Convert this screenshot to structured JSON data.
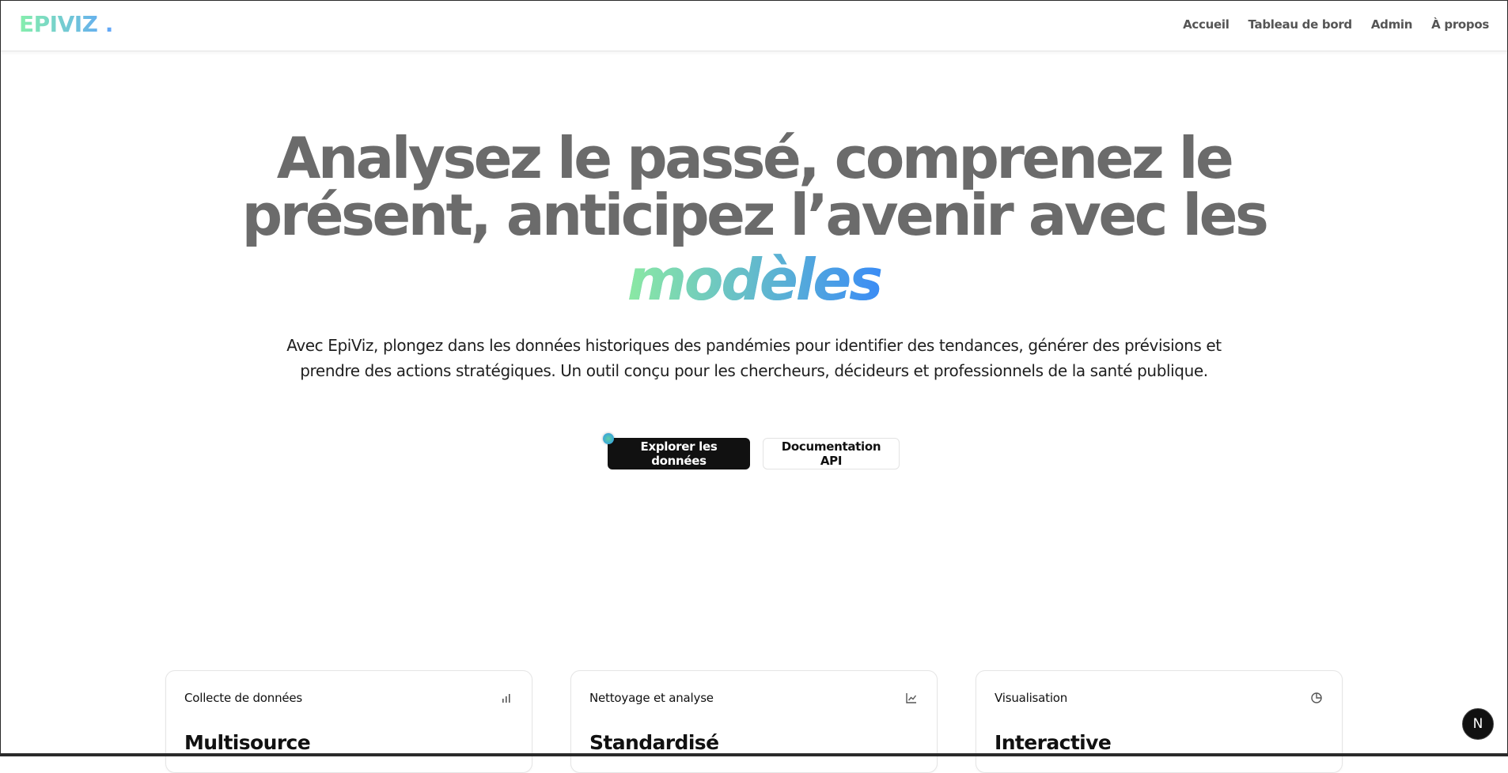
{
  "header": {
    "logo": "EPIVIZ .",
    "nav": [
      "Accueil",
      "Tableau de bord",
      "Admin",
      "À propos"
    ]
  },
  "hero": {
    "title_line1": "Analysez le passé, comprenez le",
    "title_line2": "présent, anticipez l’avenir avec les",
    "title_accent": "modèles",
    "subtitle": "Avec EpiViz, plongez dans les données historiques des pandémies pour identifier des tendances, générer des prévisions et prendre des actions stratégiques. Un outil conçu pour les chercheurs, décideurs et professionnels de la santé publique.",
    "primary_button": "Explorer les données",
    "secondary_button": "Documentation API"
  },
  "cards": [
    {
      "label": "Collecte de données",
      "value": "Multisource",
      "icon": "bar-chart-icon"
    },
    {
      "label": "Nettoyage et analyse",
      "value": "Standardisé",
      "icon": "line-chart-icon"
    },
    {
      "label": "Visualisation",
      "value": "Interactive",
      "icon": "pie-chart-icon"
    }
  ],
  "badge": "N",
  "colors": {
    "gradient_start": "#86efac",
    "gradient_end": "#3b82f6",
    "title_gray": "#6b6b6b",
    "primary_button_bg": "#111111"
  }
}
